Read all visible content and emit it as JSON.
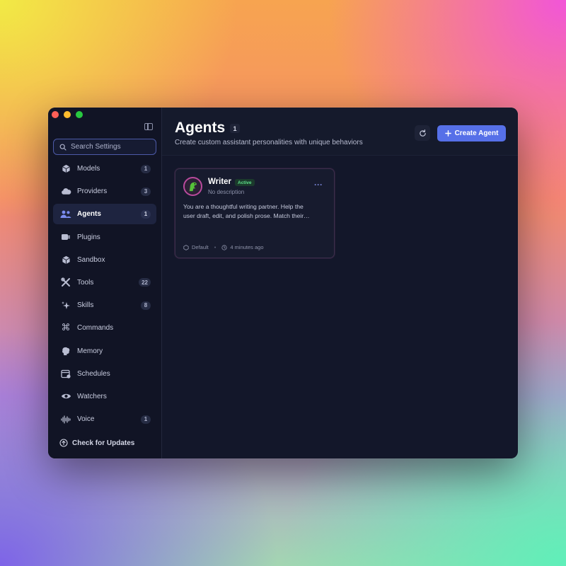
{
  "colors": {
    "accent": "#5670e8",
    "window_bg": "#13172a",
    "sidebar_bg": "#111425",
    "active_badge_text": "#5ee08a",
    "avatar_ring": "#b84a9c"
  },
  "search": {
    "placeholder": "Search Settings",
    "icon": "search-icon"
  },
  "sidebar": {
    "items": [
      {
        "label": "Models",
        "icon": "cube-icon",
        "badge": "1",
        "active": false
      },
      {
        "label": "Providers",
        "icon": "cloud-icon",
        "badge": "3",
        "active": false
      },
      {
        "label": "Agents",
        "icon": "users-icon",
        "badge": "1",
        "active": true
      },
      {
        "label": "Plugins",
        "icon": "plugin-icon",
        "badge": "",
        "active": false
      },
      {
        "label": "Sandbox",
        "icon": "box-icon",
        "badge": "",
        "active": false
      },
      {
        "label": "Tools",
        "icon": "tools-icon",
        "badge": "22",
        "active": false
      },
      {
        "label": "Skills",
        "icon": "sparkle-icon",
        "badge": "8",
        "active": false
      },
      {
        "label": "Commands",
        "icon": "command-icon",
        "badge": "",
        "active": false
      },
      {
        "label": "Memory",
        "icon": "brain-icon",
        "badge": "",
        "active": false
      },
      {
        "label": "Schedules",
        "icon": "calendar-icon",
        "badge": "",
        "active": false
      },
      {
        "label": "Watchers",
        "icon": "eye-icon",
        "badge": "",
        "active": false
      },
      {
        "label": "Voice",
        "icon": "waveform-icon",
        "badge": "1",
        "active": false
      }
    ],
    "footer": {
      "label": "Check for Updates",
      "icon": "arrow-up-circle-icon"
    }
  },
  "header": {
    "title": "Agents",
    "count": "1",
    "subtitle": "Create custom assistant personalities with unique behaviors",
    "refresh_icon": "refresh-icon",
    "create_label": "Create Agent",
    "create_icon": "plus-icon"
  },
  "agents": [
    {
      "name": "Writer",
      "status": "Active",
      "description": "No description",
      "prompt_line1": "You are a thoughtful writing partner. Help the",
      "prompt_line2": "user draft, edit, and polish prose. Match their…",
      "model": "Default",
      "updated": "4 minutes ago",
      "more_label": "···"
    }
  ]
}
